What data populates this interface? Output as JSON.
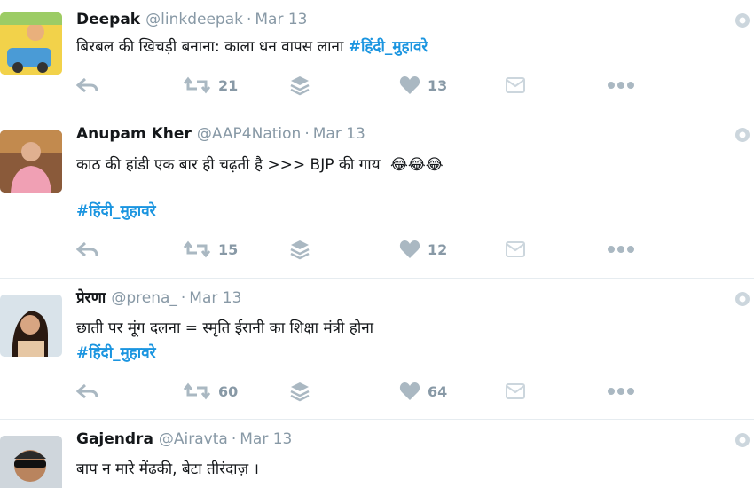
{
  "tweets": [
    {
      "name": "Deepak",
      "handle": "@linkdeepak",
      "dot": "·",
      "time": "Mar 13",
      "text": "बिरबल की खिचड़ी बनाना: काला धन वापस लाना ",
      "hashtag": "#हिंदी_मुहावरे",
      "retweets": "21",
      "likes": "13"
    },
    {
      "name": "Anupam Kher",
      "handle": "@AAP4Nation",
      "dot": "·",
      "time": "Mar 13",
      "text": "काठ की हांडी एक बार ही चढ़ती है  >>>  BJP की गाय ",
      "emoji": "😂😂😂",
      "hashtag": "#हिंदी_मुहावरे",
      "retweets": "15",
      "likes": "12"
    },
    {
      "name": "प्रेरणा",
      "handle": "@prena_",
      "dot": "·",
      "time": "Mar 13",
      "text": "छाती पर मूंग दलना = स्मृति ईरानी का शिक्षा मंत्री होना",
      "hashtag": "#हिंदी_मुहावरे",
      "retweets": "60",
      "likes": "64"
    },
    {
      "name": "Gajendra",
      "handle": "@Airavta",
      "dot": "·",
      "time": "Mar 13",
      "text": "बाप न मारे मेंढकी, बेटा तीरंदाज़ ।"
    }
  ],
  "icons": {
    "reply": "reply-icon",
    "retweet": "retweet-icon",
    "stack": "stack-icon",
    "like": "heart-icon",
    "dm": "message-icon",
    "more": "more-icon",
    "globe": "globe-icon"
  },
  "colors": {
    "hashtag": "#1b95e0",
    "muted": "#8899a6",
    "icon": "#aab8c2",
    "divider": "#e6ecf0"
  }
}
